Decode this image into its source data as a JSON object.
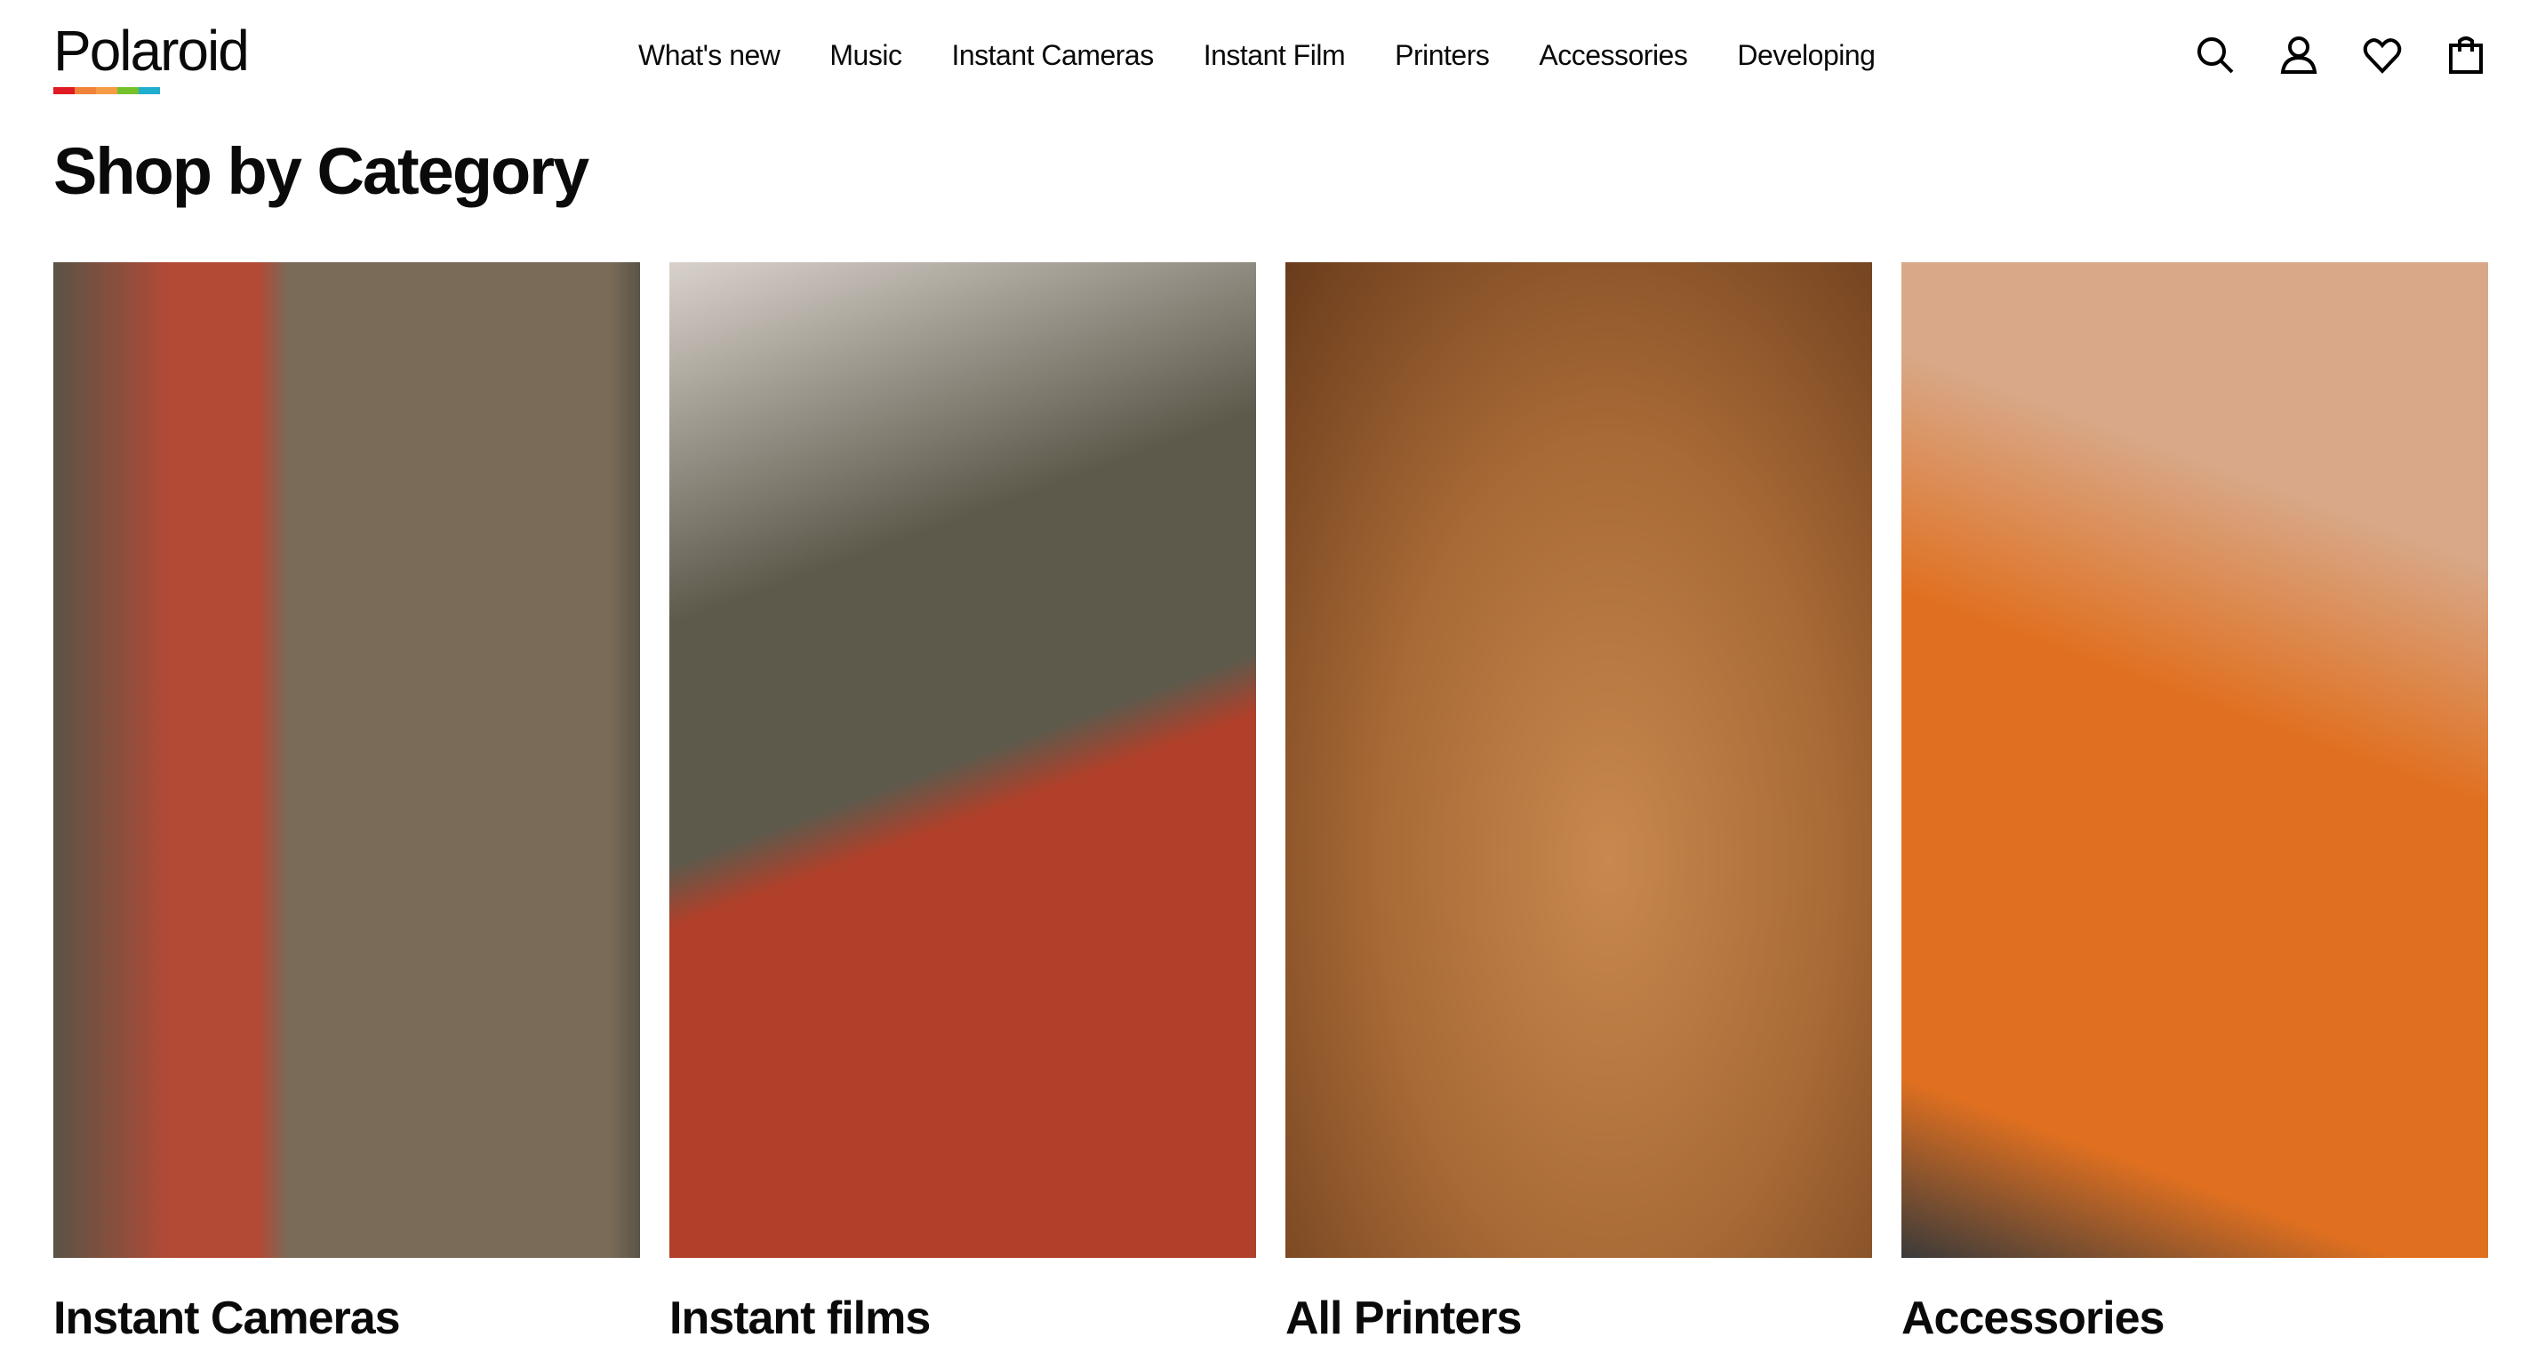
{
  "header": {
    "logo": "Polaroid",
    "logo_stripe_colors": [
      "#e01b24",
      "#f0823a",
      "#f59a45",
      "#74c12a",
      "#1faecd"
    ],
    "nav": [
      "What's new",
      "Music",
      "Instant Cameras",
      "Instant Film",
      "Printers",
      "Accessories",
      "Developing"
    ],
    "icons": [
      "search-icon",
      "account-icon",
      "wishlist-heart-icon",
      "shopping-bag-icon"
    ]
  },
  "main": {
    "title": "Shop by Category",
    "categories": [
      {
        "label": "Instant Cameras",
        "colors": [
          "#7a6a58",
          "#b24a36",
          "#5a5446"
        ]
      },
      {
        "label": "Instant films",
        "colors": [
          "#5d5a4c",
          "#b0402a",
          "#d9d2cc"
        ]
      },
      {
        "label": "All Printers",
        "colors": [
          "#a86a36",
          "#c8884e",
          "#6a3c1c"
        ]
      },
      {
        "label": "Accessories",
        "colors": [
          "#e07020",
          "#d8a888",
          "#3a3a3a"
        ]
      }
    ]
  }
}
